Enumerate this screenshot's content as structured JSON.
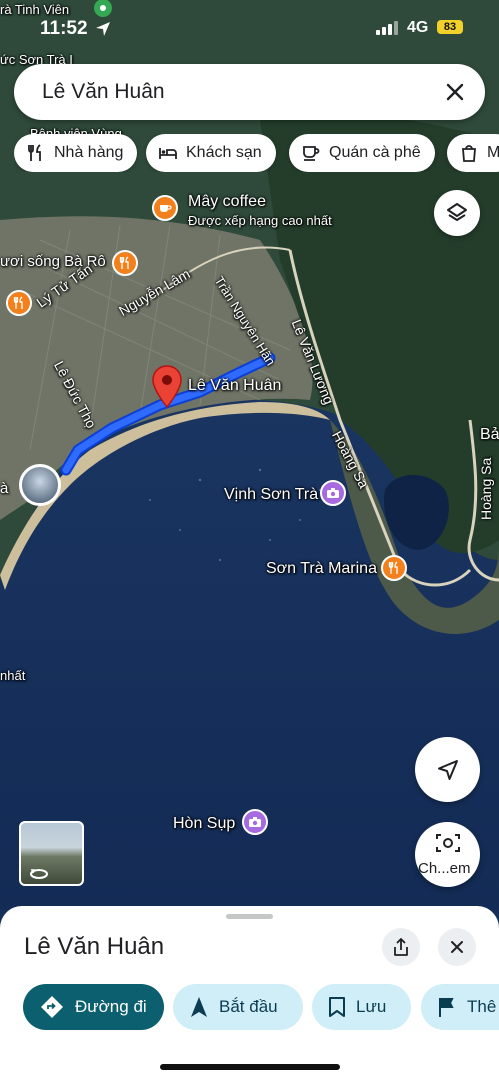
{
  "status_bar": {
    "time": "11:52",
    "network": "4G",
    "battery": "83"
  },
  "search": {
    "query": "Lê Văn Huân"
  },
  "chips": [
    {
      "label": "Nhà hàng",
      "icon": "fork-knife-icon"
    },
    {
      "label": "Khách sạn",
      "icon": "bed-icon"
    },
    {
      "label": "Quán cà phê",
      "icon": "coffee-cup-icon"
    },
    {
      "label": "M",
      "icon": "shopping-bag-icon"
    }
  ],
  "map": {
    "top_labels": [
      "rà Tinh Viên",
      "ức Sơn Trà I",
      "Bệnh viện Vùng"
    ],
    "places": {
      "may_coffee": {
        "name": "Mây coffee",
        "subtitle": "Được xếp hạng cao nhất"
      },
      "ba_ro": "ươi sống Bà Rô",
      "le_van_huan": "Lê Văn Huân",
      "vinh_son_tra": "Vịnh Sơn Trà",
      "son_tra_marina": "Sơn Trà Marina",
      "hon_sup": "Hòn Sụp",
      "edge_left": "à",
      "edge_right": "Bả",
      "edge_nhat": "nhất"
    },
    "roads": {
      "ly_tu_tan": "Lý Tử Tấn",
      "nguyen_lam": "Nguyễn Lâm",
      "tran_nguyen_han": "Trần Nguyên Hãn",
      "le_van_luong": "Lê Văn Lương",
      "le_duc_tho": "Lê Đức Thọ",
      "hoang_sa_1": "Hoàng Sa",
      "hoang_sa_2": "Hoàng Sa"
    },
    "colors": {
      "route": "#1a5cff",
      "pin": "#ea4335",
      "food_pin": "#f2811d",
      "photo_pin": "#a66be0"
    }
  },
  "lens": {
    "label": "Ch...em"
  },
  "sheet": {
    "title": "Lê Văn Huân",
    "actions": [
      {
        "label": "Đường đi",
        "icon": "directions-icon",
        "primary": true
      },
      {
        "label": "Bắt đầu",
        "icon": "navigation-arrow-icon"
      },
      {
        "label": "Lưu",
        "icon": "bookmark-icon"
      },
      {
        "label": "Thê",
        "icon": "flag-icon"
      }
    ]
  }
}
